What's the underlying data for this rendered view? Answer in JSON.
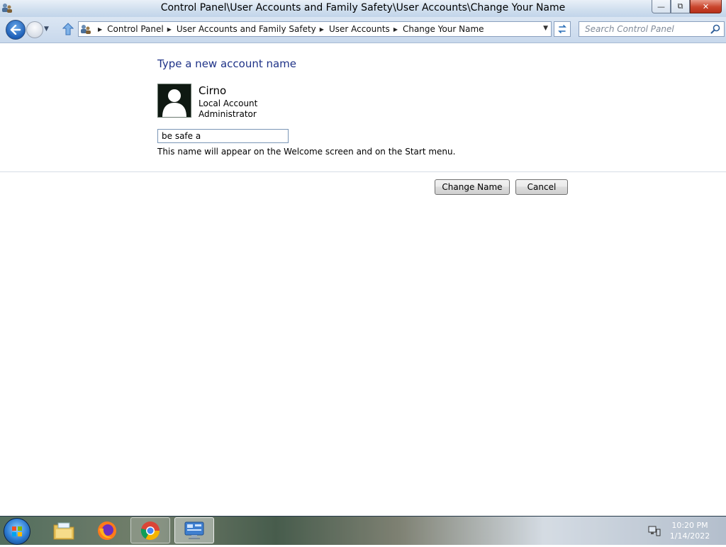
{
  "window": {
    "title": "Control Panel\\User Accounts and Family Safety\\User Accounts\\Change Your Name",
    "buttons": {
      "minimize": "—",
      "restore": "⧉",
      "close": "✕"
    }
  },
  "navigation": {
    "breadcrumbs": [
      "Control Panel",
      "User Accounts and Family Safety",
      "User Accounts",
      "Change Your Name"
    ],
    "search_placeholder": "Search Control Panel"
  },
  "content": {
    "heading": "Type a new account name",
    "account": {
      "name": "Cirno",
      "type": "Local Account",
      "role": "Administrator"
    },
    "new_name_value": "be safe a",
    "hint": "This name will appear on the Welcome screen and on the Start menu.",
    "buttons": {
      "change": "Change Name",
      "cancel": "Cancel"
    }
  },
  "taskbar": {
    "items": [
      "windows-explorer-icon",
      "firefox-icon",
      "chrome-icon",
      "control-panel-icon"
    ],
    "clock": {
      "time": "10:20 PM",
      "date": "1/14/2022"
    }
  },
  "colors": {
    "heading": "#1e3287",
    "titlebar": "#cfdeee",
    "close_button": "#c9452c"
  }
}
